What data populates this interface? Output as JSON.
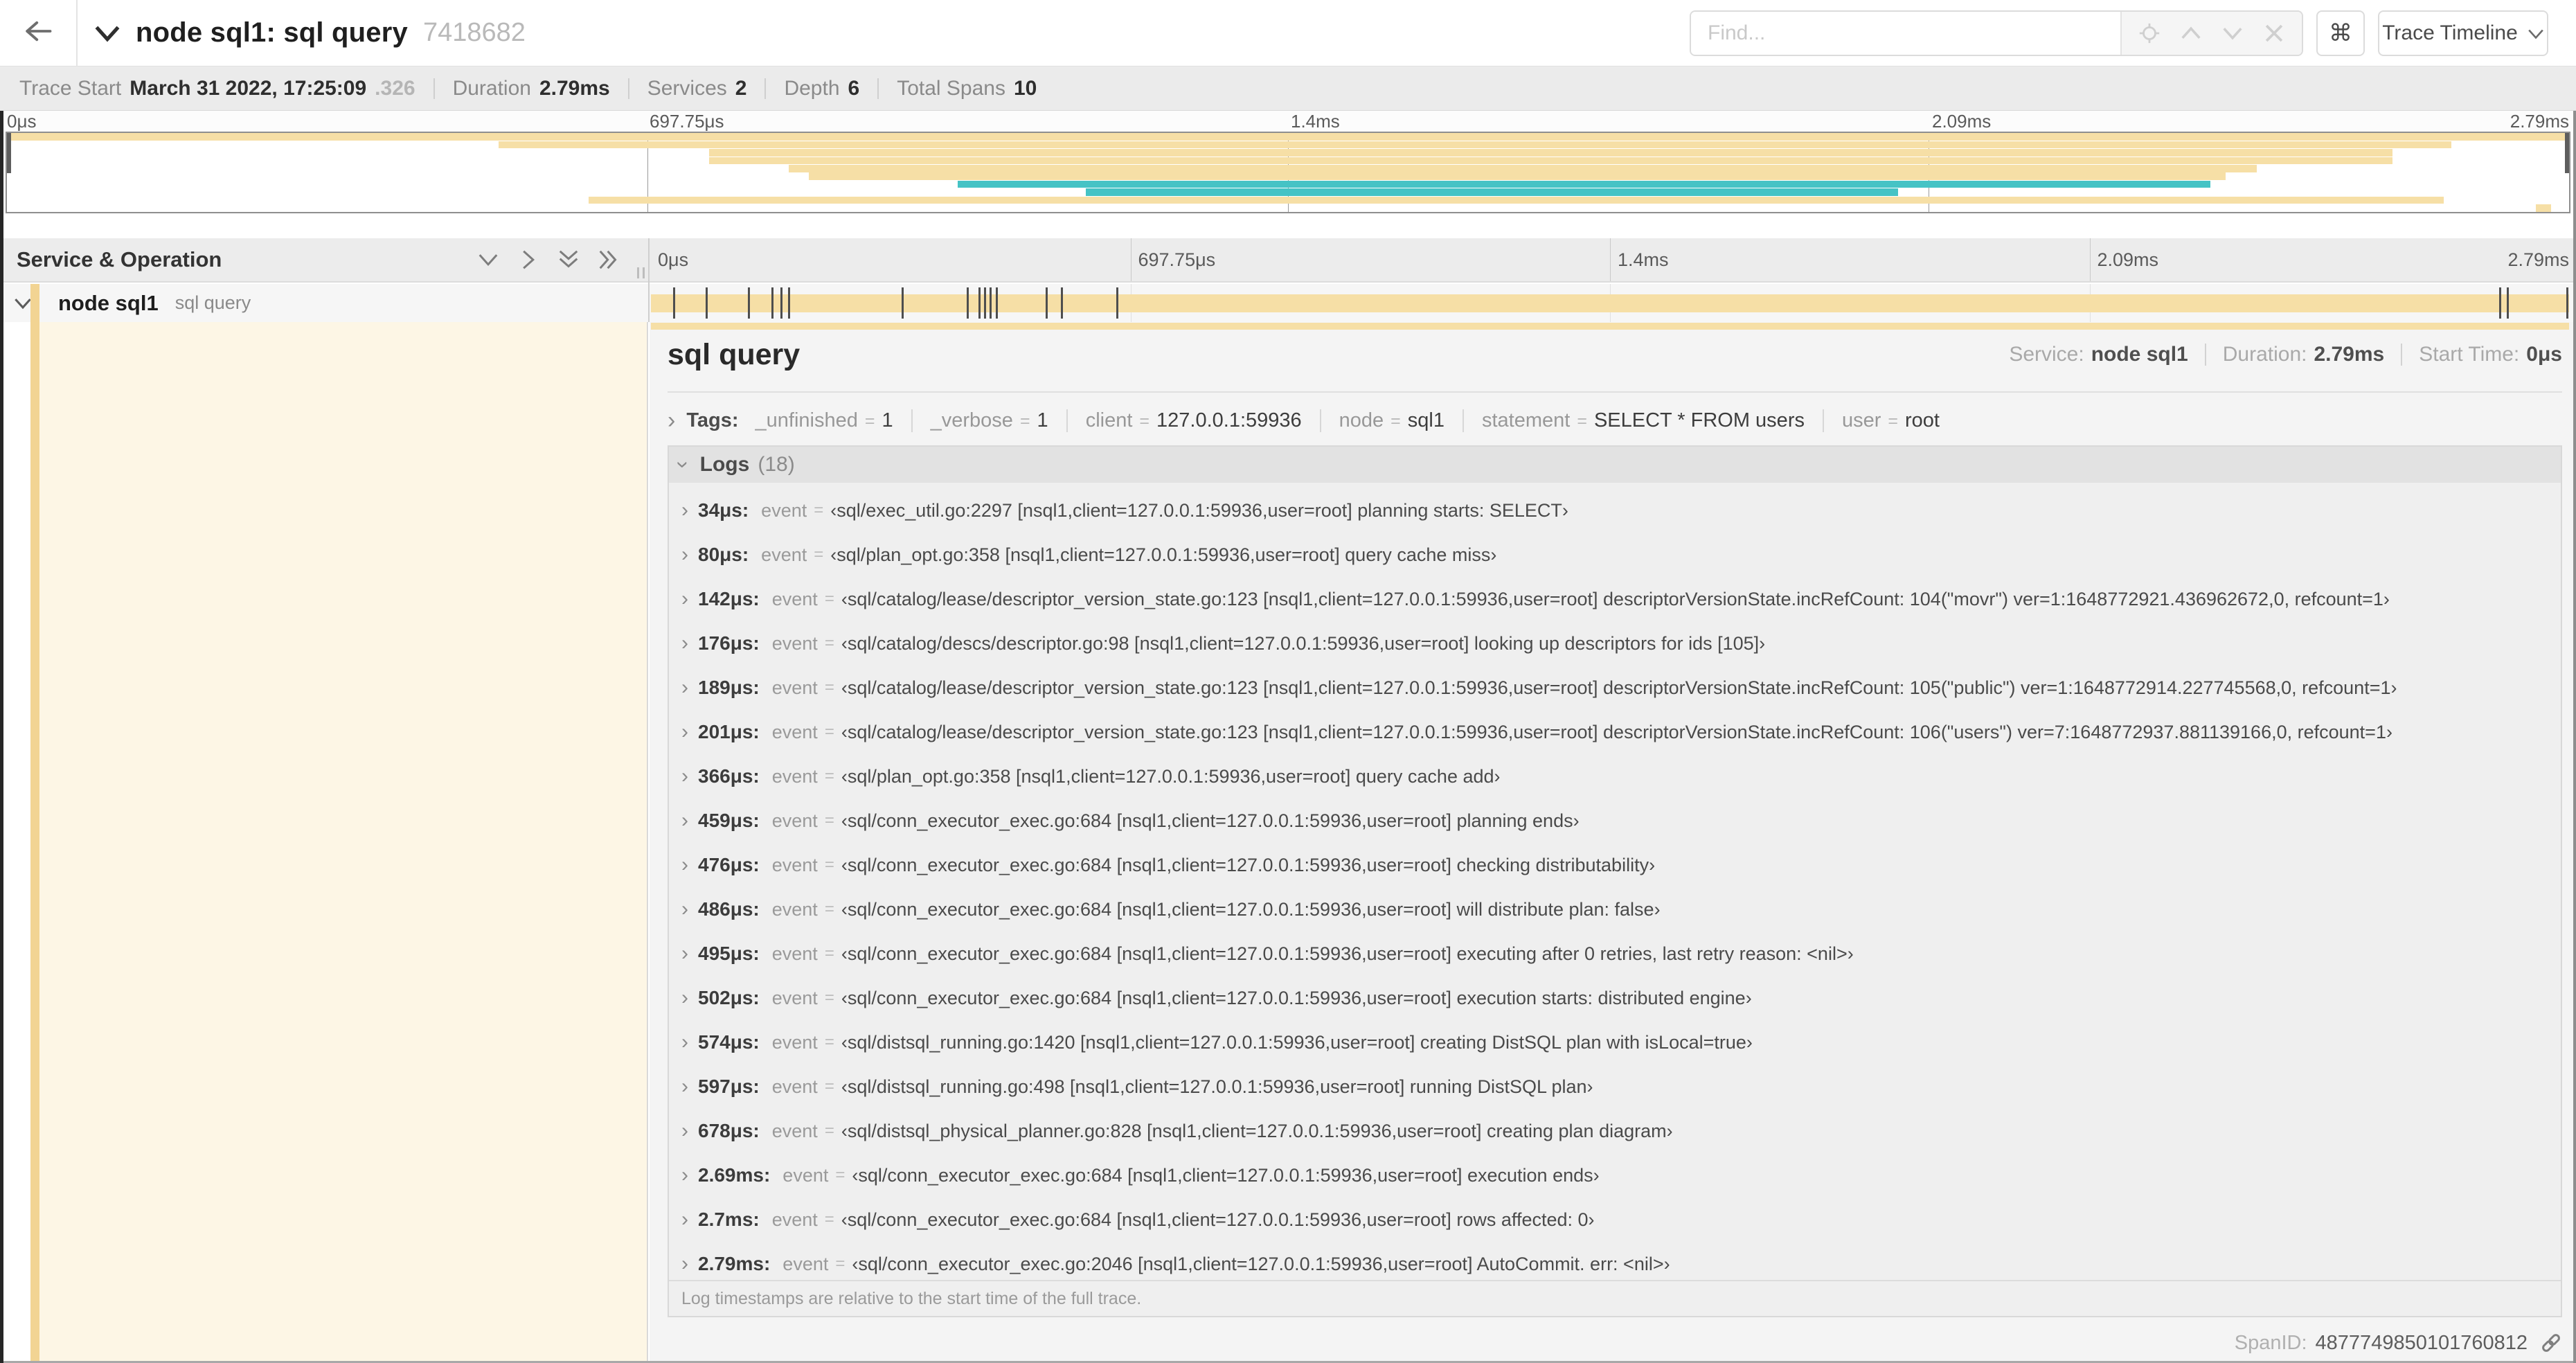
{
  "colors": {
    "khaki": "#f6dfa6",
    "khaki_strip": "#f2d493",
    "teal": "#45c3c5",
    "cream": "#fdf6e5"
  },
  "header": {
    "back_icon": "arrow-left",
    "title": "node sql1: sql query",
    "trace_id": "7418682",
    "find_placeholder": "Find...",
    "shortcut_icon": "⌘",
    "view_selector": "Trace Timeline"
  },
  "summary": {
    "items": [
      {
        "label": "Trace Start",
        "value": "March 31 2022, 17:25:09",
        "suffix": ".326"
      },
      {
        "label": "Duration",
        "value": "2.79ms"
      },
      {
        "label": "Services",
        "value": "2"
      },
      {
        "label": "Depth",
        "value": "6"
      },
      {
        "label": "Total Spans",
        "value": "10"
      }
    ]
  },
  "minimap": {
    "ticks": [
      {
        "label": "0μs",
        "pct": 0
      },
      {
        "label": "697.75μs",
        "pct": 25
      },
      {
        "label": "1.4ms",
        "pct": 50
      },
      {
        "label": "2.09ms",
        "pct": 75
      },
      {
        "label": "2.79ms",
        "pct": 100
      }
    ],
    "spans": [
      {
        "start": 0,
        "end": 100,
        "color": "khaki"
      },
      {
        "start": 19.2,
        "end": 95.4,
        "color": "khaki"
      },
      {
        "start": 27.4,
        "end": 93.1,
        "color": "khaki"
      },
      {
        "start": 27.4,
        "end": 93.1,
        "color": "khaki"
      },
      {
        "start": 30.5,
        "end": 87.8,
        "color": "khaki"
      },
      {
        "start": 31.3,
        "end": 86.6,
        "color": "khaki"
      },
      {
        "start": 37.1,
        "end": 86.0,
        "color": "teal"
      },
      {
        "start": 42.1,
        "end": 73.8,
        "color": "teal"
      },
      {
        "start": 22.7,
        "end": 95.1,
        "color": "khaki"
      },
      {
        "start": 98.7,
        "end": 99.3,
        "color": "khaki"
      }
    ]
  },
  "timeline": {
    "left_header": "Service & Operation",
    "row": {
      "service": "node sql1",
      "operation": "sql query"
    },
    "gridlines_pct": [
      25,
      50,
      75
    ],
    "log_marks_pct": [
      1.2,
      2.9,
      5.1,
      6.3,
      6.8,
      7.2,
      13.1,
      16.5,
      17.1,
      17.4,
      17.7,
      18.0,
      20.6,
      21.4,
      24.3,
      96.4,
      96.8,
      99.9
    ]
  },
  "detail": {
    "operation": "sql query",
    "service_label": "Service:",
    "service": "node sql1",
    "duration_label": "Duration:",
    "duration": "2.79ms",
    "start_label": "Start Time:",
    "start": "0μs",
    "tags": {
      "label": "Tags:",
      "items": [
        {
          "key": "_unfinished",
          "value": "1"
        },
        {
          "key": "_verbose",
          "value": "1"
        },
        {
          "key": "client",
          "value": "127.0.0.1:59936"
        },
        {
          "key": "node",
          "value": "sql1"
        },
        {
          "key": "statement",
          "value": "SELECT * FROM users"
        },
        {
          "key": "user",
          "value": "root"
        }
      ]
    },
    "logs": {
      "label": "Logs",
      "count": "(18)",
      "entries": [
        {
          "time": "34μs:",
          "key": "event",
          "value": "‹sql/exec_util.go:2297 [nsql1,client=127.0.0.1:59936,user=root] planning starts: SELECT›"
        },
        {
          "time": "80μs:",
          "key": "event",
          "value": "‹sql/plan_opt.go:358 [nsql1,client=127.0.0.1:59936,user=root] query cache miss›"
        },
        {
          "time": "142μs:",
          "key": "event",
          "value": "‹sql/catalog/lease/descriptor_version_state.go:123 [nsql1,client=127.0.0.1:59936,user=root] descriptorVersionState.incRefCount: 104(\"movr\") ver=1:1648772921.436962672,0, refcount=1›"
        },
        {
          "time": "176μs:",
          "key": "event",
          "value": "‹sql/catalog/descs/descriptor.go:98 [nsql1,client=127.0.0.1:59936,user=root] looking up descriptors for ids [105]›"
        },
        {
          "time": "189μs:",
          "key": "event",
          "value": "‹sql/catalog/lease/descriptor_version_state.go:123 [nsql1,client=127.0.0.1:59936,user=root] descriptorVersionState.incRefCount: 105(\"public\") ver=1:1648772914.227745568,0, refcount=1›"
        },
        {
          "time": "201μs:",
          "key": "event",
          "value": "‹sql/catalog/lease/descriptor_version_state.go:123 [nsql1,client=127.0.0.1:59936,user=root] descriptorVersionState.incRefCount: 106(\"users\") ver=7:1648772937.881139166,0, refcount=1›"
        },
        {
          "time": "366μs:",
          "key": "event",
          "value": "‹sql/plan_opt.go:358 [nsql1,client=127.0.0.1:59936,user=root] query cache add›"
        },
        {
          "time": "459μs:",
          "key": "event",
          "value": "‹sql/conn_executor_exec.go:684 [nsql1,client=127.0.0.1:59936,user=root] planning ends›"
        },
        {
          "time": "476μs:",
          "key": "event",
          "value": "‹sql/conn_executor_exec.go:684 [nsql1,client=127.0.0.1:59936,user=root] checking distributability›"
        },
        {
          "time": "486μs:",
          "key": "event",
          "value": "‹sql/conn_executor_exec.go:684 [nsql1,client=127.0.0.1:59936,user=root] will distribute plan: false›"
        },
        {
          "time": "495μs:",
          "key": "event",
          "value": "‹sql/conn_executor_exec.go:684 [nsql1,client=127.0.0.1:59936,user=root] executing after 0 retries, last retry reason: <nil>›"
        },
        {
          "time": "502μs:",
          "key": "event",
          "value": "‹sql/conn_executor_exec.go:684 [nsql1,client=127.0.0.1:59936,user=root] execution starts: distributed engine›"
        },
        {
          "time": "574μs:",
          "key": "event",
          "value": "‹sql/distsql_running.go:1420 [nsql1,client=127.0.0.1:59936,user=root] creating DistSQL plan with isLocal=true›"
        },
        {
          "time": "597μs:",
          "key": "event",
          "value": "‹sql/distsql_running.go:498 [nsql1,client=127.0.0.1:59936,user=root] running DistSQL plan›"
        },
        {
          "time": "678μs:",
          "key": "event",
          "value": "‹sql/distsql_physical_planner.go:828 [nsql1,client=127.0.0.1:59936,user=root] creating plan diagram›"
        },
        {
          "time": "2.69ms:",
          "key": "event",
          "value": "‹sql/conn_executor_exec.go:684 [nsql1,client=127.0.0.1:59936,user=root] execution ends›"
        },
        {
          "time": "2.7ms:",
          "key": "event",
          "value": "‹sql/conn_executor_exec.go:684 [nsql1,client=127.0.0.1:59936,user=root] rows affected: 0›"
        },
        {
          "time": "2.79ms:",
          "key": "event",
          "value": "‹sql/conn_executor_exec.go:2046 [nsql1,client=127.0.0.1:59936,user=root] AutoCommit. err: <nil>›"
        }
      ],
      "footnote": "Log timestamps are relative to the start time of the full trace."
    },
    "span_id_label": "SpanID:",
    "span_id": "4877749850101760812"
  }
}
